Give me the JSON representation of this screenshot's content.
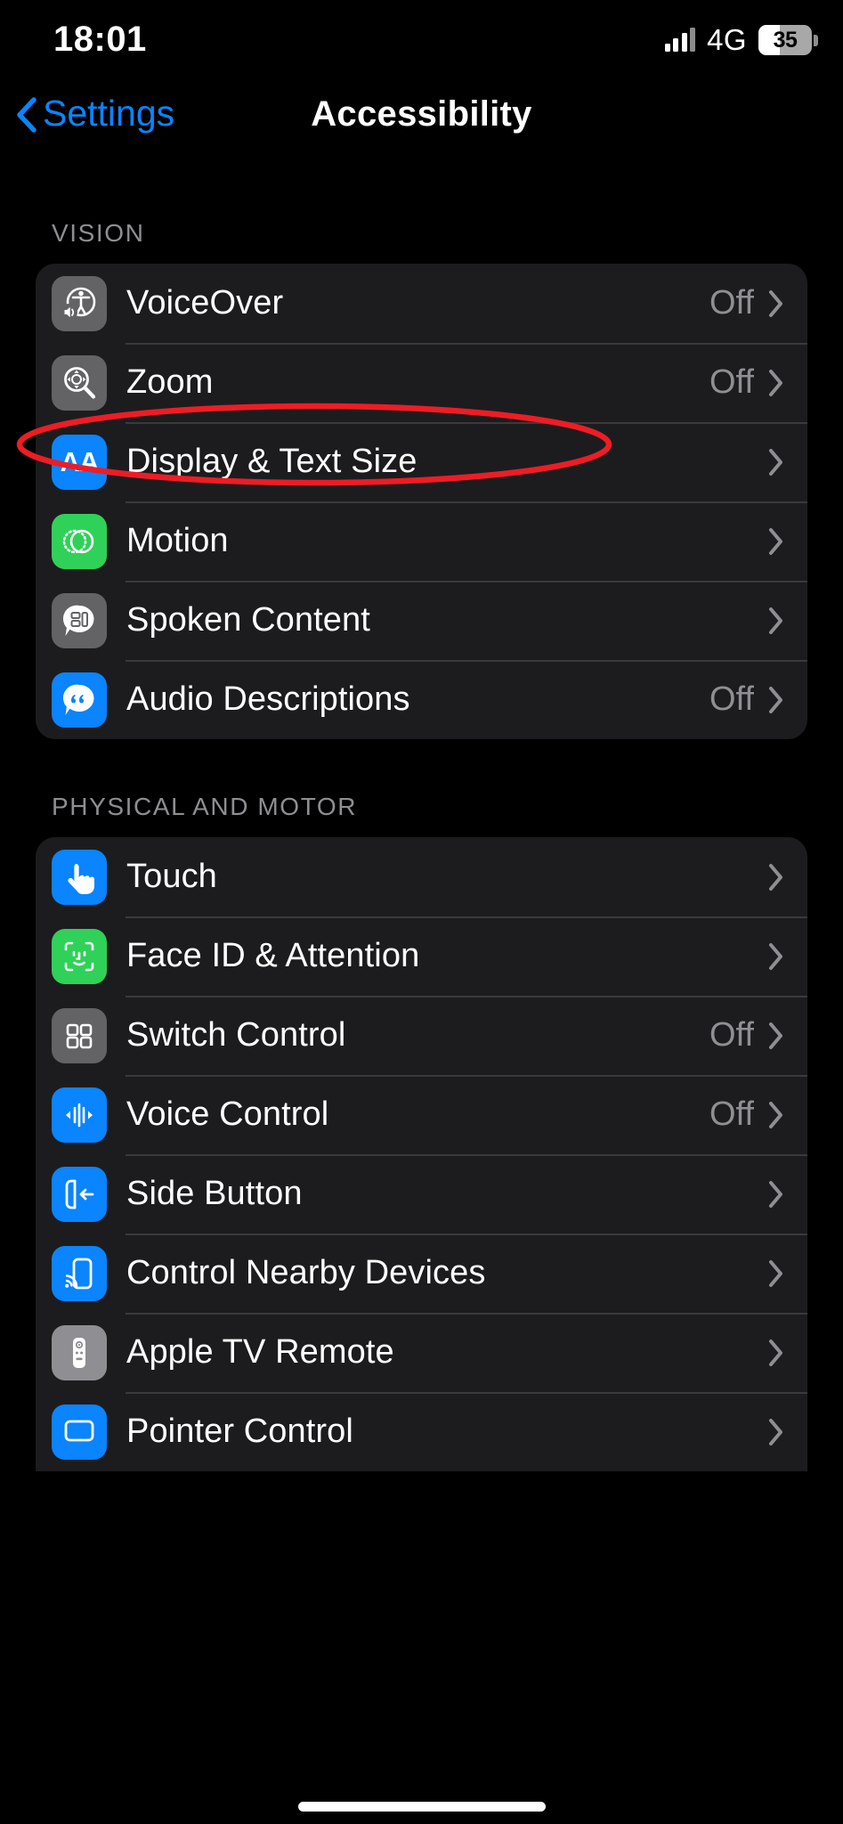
{
  "status_bar": {
    "time": "18:01",
    "network": "4G",
    "battery_percent": "35",
    "signal_icon": "cellular-signal-icon",
    "battery_icon": "battery-icon"
  },
  "nav": {
    "back_label": "Settings",
    "back_icon": "chevron-left-icon",
    "title": "Accessibility"
  },
  "colors": {
    "accent_blue": "#0a84ff",
    "green": "#30d158",
    "gray_icon": "#636366",
    "card_bg": "#1c1c1e",
    "secondary_text": "#8e8e93",
    "annotation_red": "#ee1c25"
  },
  "sections": [
    {
      "header": "VISION",
      "rows": [
        {
          "label": "VoiceOver",
          "value": "Off",
          "icon": "voiceover-icon",
          "icon_color": "gray"
        },
        {
          "label": "Zoom",
          "value": "Off",
          "icon": "zoom-magnifier-icon",
          "icon_color": "gray"
        },
        {
          "label": "Display & Text Size",
          "value": "",
          "icon": "display-text-size-aa-icon",
          "icon_color": "blue"
        },
        {
          "label": "Motion",
          "value": "",
          "icon": "motion-icon",
          "icon_color": "green"
        },
        {
          "label": "Spoken Content",
          "value": "",
          "icon": "spoken-content-icon",
          "icon_color": "gray"
        },
        {
          "label": "Audio Descriptions",
          "value": "Off",
          "icon": "audio-descriptions-icon",
          "icon_color": "blue"
        }
      ]
    },
    {
      "header": "PHYSICAL AND MOTOR",
      "rows": [
        {
          "label": "Touch",
          "value": "",
          "icon": "touch-hand-icon",
          "icon_color": "blue"
        },
        {
          "label": "Face ID & Attention",
          "value": "",
          "icon": "face-id-icon",
          "icon_color": "green"
        },
        {
          "label": "Switch Control",
          "value": "Off",
          "icon": "switch-control-icon",
          "icon_color": "gray"
        },
        {
          "label": "Voice Control",
          "value": "Off",
          "icon": "voice-control-icon",
          "icon_color": "blue"
        },
        {
          "label": "Side Button",
          "value": "",
          "icon": "side-button-icon",
          "icon_color": "blue"
        },
        {
          "label": "Control Nearby Devices",
          "value": "",
          "icon": "nearby-devices-icon",
          "icon_color": "blue"
        },
        {
          "label": "Apple TV Remote",
          "value": "",
          "icon": "apple-tv-remote-icon",
          "icon_color": "gray2"
        },
        {
          "label": "Pointer Control",
          "value": "",
          "icon": "pointer-control-icon",
          "icon_color": "blue"
        }
      ]
    }
  ],
  "annotation": {
    "shape": "ellipse",
    "color": "#ee1c25",
    "targets_row": "Display & Text Size"
  }
}
